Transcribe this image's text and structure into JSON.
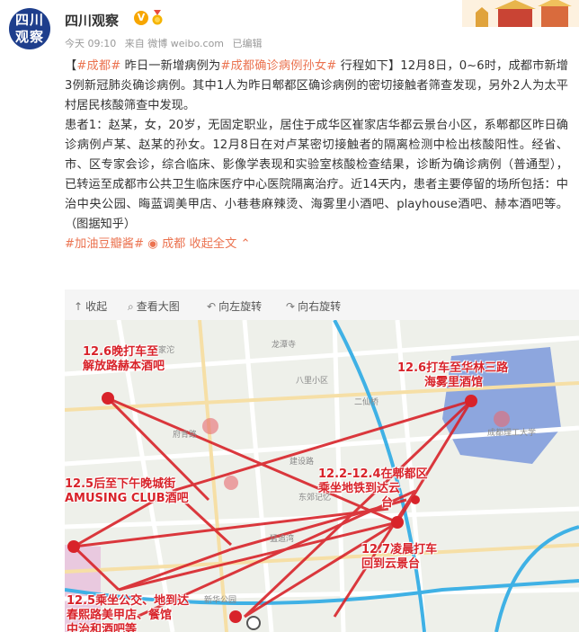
{
  "account": {
    "avatar_line1": "四川",
    "avatar_line2": "观察",
    "name": "四川观察",
    "verified_icon": "verified-v-icon",
    "time": "今天 09:10",
    "source": "来自 微博 weibo.com",
    "edited": "已编辑"
  },
  "post": {
    "p1_bracket_open": "【",
    "p1_tag": "#成都#",
    "p1_mid": " 昨日一新增病例为",
    "p1_tag2": "#成都确诊病例孙女#",
    "p1_rest": " 行程如下】12月8日，0~6时，成都市新增3例新冠肺炎确诊病例。其中1人为昨日郫都区确诊病例的密切接触者筛查发现，另外2人为太平村居民核酸筛查中发现。",
    "p2": "患者1：赵某，女，20岁，无固定职业，居住于成华区崔家店华都云景台小区，系郫都区昨日确诊病例卢某、赵某的孙女。12月8日在对卢某密切接触者的隔离检测中检出核酸阳性。经省、市、区专家会诊，综合临床、影像学表现和实验室核酸检查结果，诊断为确诊病例（普通型），已转运至成都市公共卫生临床医疗中心医院隔离治疗。近14天内，患者主要停留的场所包括：中治中央公园、晦蓝调美甲店、小巷巷麻辣烫、海雾里小酒吧、playhouse酒吧、赫本酒吧等。（图据知乎）",
    "footer_tag": "#加油豆瓣酱#",
    "footer_location": "成都",
    "footer_collapse": "收起全文"
  },
  "toolbar": {
    "collapse": "收起",
    "view_large": "查看大图",
    "rotate_left": "向左旋转",
    "rotate_right": "向右旋转"
  },
  "map": {
    "labels": {
      "l1a": "12.6晚打车至",
      "l1b": "解放路赫本酒吧",
      "l2a": "12.6打车至华林三路",
      "l2b": "海雾里酒馆",
      "l3a": "12.5后至下午晚城街",
      "l3b": "AMUSING CLUB酒吧",
      "l4a": "12.2-12.4在郫都区",
      "l4b": "乘坐地铁到达云",
      "l4c": "台",
      "l5a": "12.7凌晨打车",
      "l5b": "回到云景台",
      "l6a": "12.5乘坐公交、地到达",
      "l6b": "春熙路美甲店、餐馆",
      "l6c": "中治和酒吧等"
    },
    "places": {
      "p1": "李家沱",
      "p2": "八里小区",
      "p3": "二仙桥",
      "p4": "成都理工大学",
      "p5": "新华公园",
      "p6": "猛追湾",
      "p7": "建设路",
      "p8": "龙潭寺",
      "p9": "府青路",
      "p10": "东郊记忆"
    },
    "colors": {
      "route": "#d8232a",
      "road": "#ffffff",
      "ring_road": "#3fb1e5",
      "campus": "#6f8fd6"
    }
  }
}
